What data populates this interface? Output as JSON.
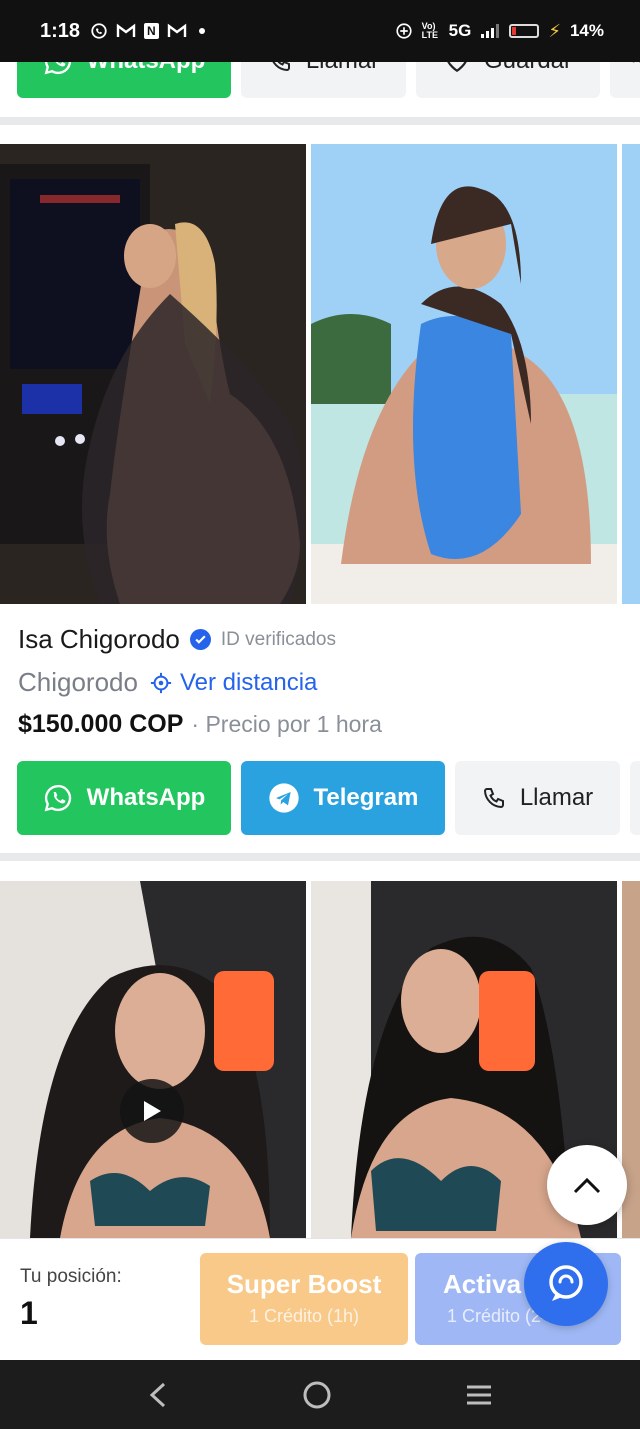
{
  "status_bar": {
    "time": "1:18",
    "network": "5G",
    "volte": "Vo) LTE",
    "battery_percent": "14%",
    "notif_n": "N"
  },
  "top_actions": {
    "whatsapp_label": "WhatsApp",
    "call_label": "Llamar",
    "save_label": "Guardar"
  },
  "listing": {
    "name": "Isa Chigorodo",
    "verified_label": "ID verificados",
    "city": "Chigorodo",
    "distance_label": "Ver distancia",
    "price": "$150.000 COP",
    "price_unit": "· Precio por 1 hora",
    "buttons": {
      "whatsapp": "WhatsApp",
      "telegram": "Telegram",
      "call": "Llamar"
    }
  },
  "boost_bar": {
    "position_label": "Tu posición:",
    "position_value": "1",
    "super_boost_title": "Super Boost",
    "super_boost_sub": "1 Crédito (1h)",
    "activa_title": "Activa",
    "activa_sub": "1 Crédito (24h)"
  },
  "colors": {
    "whatsapp": "#22c55e",
    "telegram": "#2aa2e0",
    "link_blue": "#2563eb",
    "super_boost": "#f9c98a",
    "activa": "#9fb8f5"
  }
}
